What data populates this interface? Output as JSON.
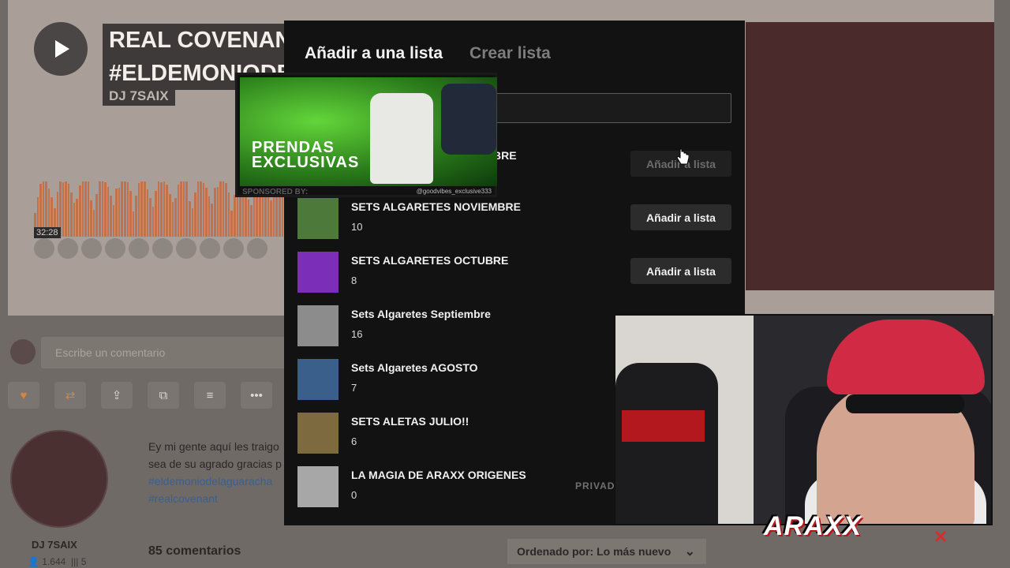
{
  "track": {
    "title_line1": "REAL COVENAN",
    "title_line2": "#ELDEMONIODE",
    "artist": "DJ 7SAIX",
    "time": "32:28"
  },
  "comment_box": {
    "placeholder": "Escribe un comentario"
  },
  "profile": {
    "name": "DJ 7SAIX",
    "followers": "1.644",
    "tracks": "5",
    "description": "Ey mi gente aquí les traigo",
    "description2": "sea de su agrado gracias p",
    "hashtags": [
      "#eldemoniodelaguaracha",
      "#realcovenant"
    ]
  },
  "comments": {
    "count_label": "85 comentarios",
    "sort_label": "Ordenado por: Lo más nuevo"
  },
  "modal": {
    "tab_add": "Añadir a una lista",
    "tab_create": "Crear lista",
    "filter_placeholder": "",
    "playlists": [
      {
        "name": "BRE",
        "count": "",
        "action": "Añadir a lista",
        "thumb_color": "#3f7a3a"
      },
      {
        "name": "SETS ALGARETES NOVIEMBRE",
        "count": "10",
        "action": "Añadir a lista",
        "thumb_color": "#4d7a3b"
      },
      {
        "name": "SETS ALGARETES OCTUBRE",
        "count": "8",
        "action": "Añadir a lista",
        "thumb_color": "#7b2fb8"
      },
      {
        "name": "Sets Algaretes Septiembre",
        "count": "16",
        "action": "",
        "thumb_color": "#8c8c8c"
      },
      {
        "name": "Sets Algaretes AGOSTO",
        "count": "7",
        "action": "",
        "thumb_color": "#3a5f8a"
      },
      {
        "name": "SETS ALETAS JULIO!!",
        "count": "6",
        "action": "",
        "thumb_color": "#7d6b3f"
      },
      {
        "name": "LA MAGIA DE ARAXX ORIGENES",
        "count": "0",
        "action": "",
        "private": "PRIVAD",
        "thumb_color": "#a7a7a7"
      }
    ]
  },
  "ad": {
    "title_line1": "PRENDAS",
    "title_line2": "EXCLUSIVAS",
    "sponsored": "SPONSORED BY:",
    "handle": "@goodvibes_exclusive333"
  },
  "stream": {
    "logo": "ARAXX",
    "close": "✕"
  }
}
